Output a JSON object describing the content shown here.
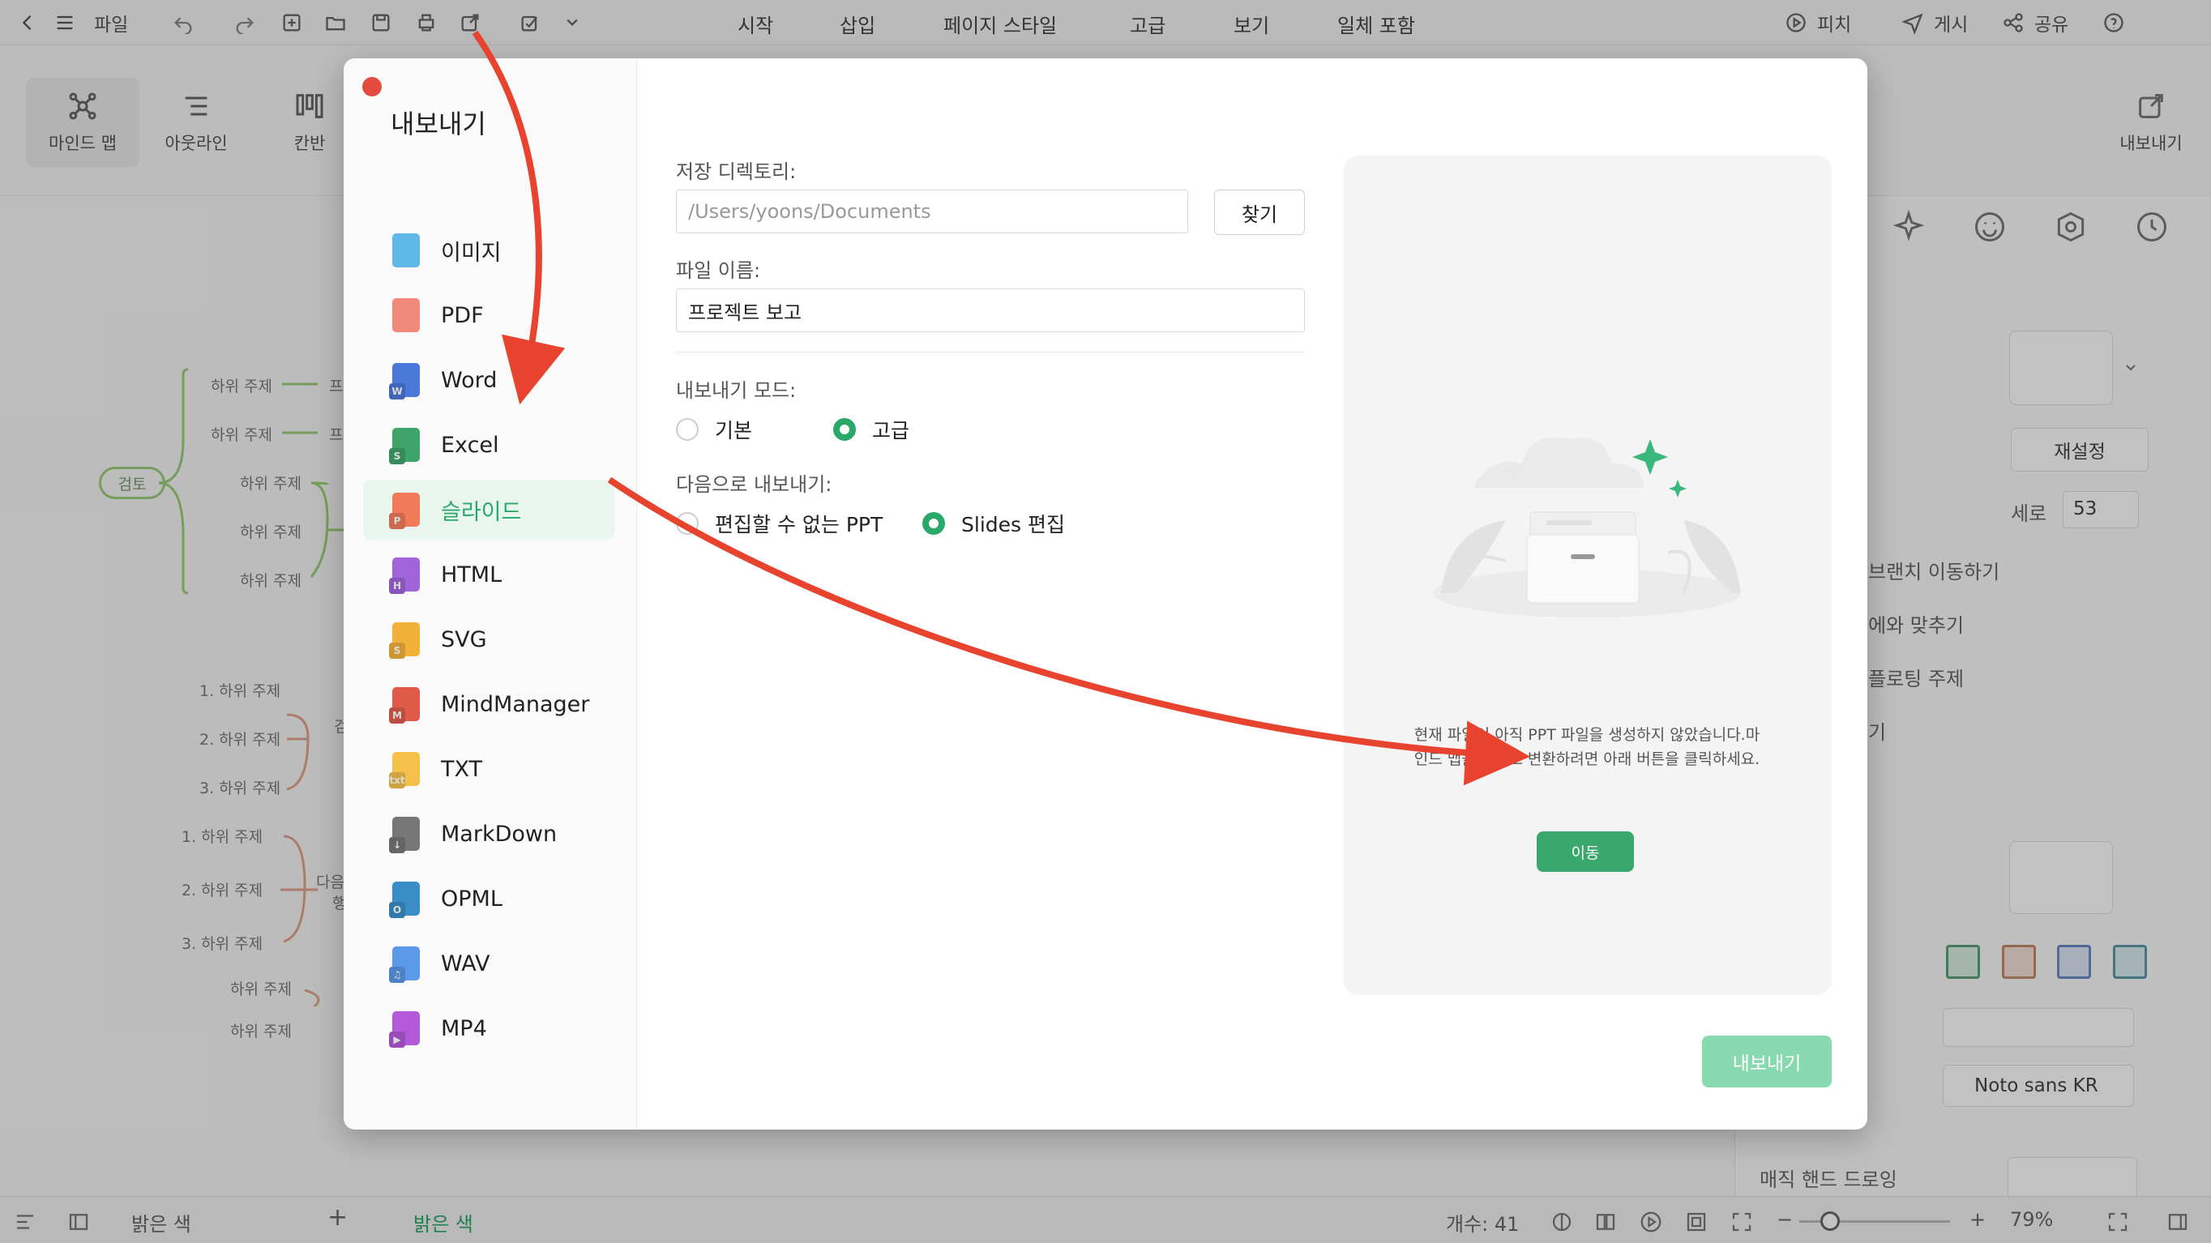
{
  "toolbar": {
    "file_label": "파일",
    "tabs": [
      "시작",
      "삽입",
      "페이지 스타일",
      "고급",
      "보기",
      "일체 포함"
    ],
    "active_tab": "시작",
    "pitch_label": "피치",
    "publish_label": "게시",
    "share_label": "공유"
  },
  "ribbon": {
    "views": [
      "마인드 맵",
      "아웃라인",
      "칸반"
    ],
    "export_label": "내보내기"
  },
  "canvas": {
    "center_topic": "검토",
    "subtopic": "하위 주제",
    "numbered": [
      "1. 하위 주제",
      "2. 하위 주제",
      "3. 하위 주제"
    ],
    "partial": [
      "프",
      "프",
      "검",
      "다음",
      "행"
    ]
  },
  "sidepanel": {
    "reset_label": "재설정",
    "height_label": "세로",
    "height_value": "53",
    "items": [
      "브랜치 이동하기",
      "에와 맞추기",
      "플로팅 주제",
      "기"
    ],
    "font_label": "Noto sans KR",
    "hand_draw_label": "매직 핸드 드로잉"
  },
  "statusbar": {
    "theme_label": "밝은 색",
    "theme_label2": "밝은 색",
    "count_label": "개수: 41",
    "zoom": "79%"
  },
  "dialog": {
    "title": "내보내기",
    "formats": [
      {
        "label": "이미지",
        "icon": "image-file-icon",
        "color": "#5fb8e8",
        "badge": ""
      },
      {
        "label": "PDF",
        "icon": "pdf-file-icon",
        "color": "#f08a7a",
        "badge": ""
      },
      {
        "label": "Word",
        "icon": "word-file-icon",
        "color": "#4a78d8",
        "badge": "W"
      },
      {
        "label": "Excel",
        "icon": "excel-file-icon",
        "color": "#3fa46a",
        "badge": "S"
      },
      {
        "label": "슬라이드",
        "icon": "slides-file-icon",
        "color": "#f07a5a",
        "badge": "P"
      },
      {
        "label": "HTML",
        "icon": "html-file-icon",
        "color": "#a064d8",
        "badge": "H"
      },
      {
        "label": "SVG",
        "icon": "svg-file-icon",
        "color": "#f2b23a",
        "badge": "S"
      },
      {
        "label": "MindManager",
        "icon": "mindmanager-file-icon",
        "color": "#e05a4a",
        "badge": "M"
      },
      {
        "label": "TXT",
        "icon": "txt-file-icon",
        "color": "#f5c04a",
        "badge": "txt"
      },
      {
        "label": "MarkDown",
        "icon": "markdown-file-icon",
        "color": "#777777",
        "badge": "↓"
      },
      {
        "label": "OPML",
        "icon": "opml-file-icon",
        "color": "#3a8ec8",
        "badge": "O"
      },
      {
        "label": "WAV",
        "icon": "wav-file-icon",
        "color": "#5a9ae8",
        "badge": "♫"
      },
      {
        "label": "MP4",
        "icon": "mp4-file-icon",
        "color": "#b45ad8",
        "badge": "▶"
      }
    ],
    "selected_format": "슬라이드",
    "save_dir_label": "저장 디렉토리:",
    "save_dir_value": "/Users/yoons/Documents",
    "browse_label": "찾기",
    "filename_label": "파일 이름:",
    "filename_value": "프로젝트 보고",
    "mode_label": "내보내기 모드:",
    "mode_options": [
      "기본",
      "고급"
    ],
    "mode_selected": "고급",
    "export_as_label": "다음으로 내보내기:",
    "export_as_options": [
      "편집할 수 없는 PPT",
      "Slides 편집"
    ],
    "export_as_selected": "Slides 편집",
    "preview_text": "현재 파일이 아직 PPT 파일을 생성하지 않았습니다.마인드 맵을 PPT로 변환하려면 아래 버튼을 클릭하세요.",
    "go_label": "이동",
    "export_button": "내보내기"
  },
  "colors": {
    "accent": "#2aa86a",
    "arrow": "#e8432e",
    "close": "#e34c3f"
  }
}
